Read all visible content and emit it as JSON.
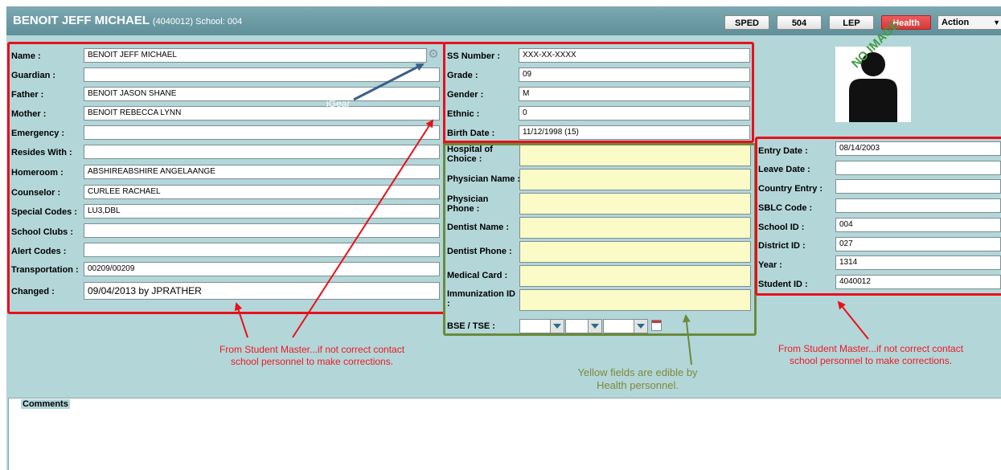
{
  "header": {
    "student_name": "BENOIT JEFF MICHAEL",
    "student_info": "(4040012) School: 004",
    "buttons": [
      "SPED",
      "504",
      "LEP",
      "Health"
    ],
    "action_label": "Action"
  },
  "left_panel": {
    "fields": [
      {
        "label": "Name :",
        "value": "BENOIT  JEFF MICHAEL"
      },
      {
        "label": "Guardian :",
        "value": ""
      },
      {
        "label": "Father :",
        "value": "BENOIT  JASON SHANE"
      },
      {
        "label": "Mother :",
        "value": "BENOIT  REBECCA LYNN"
      },
      {
        "label": "Emergency :",
        "value": ""
      },
      {
        "label": "Resides With :",
        "value": ""
      },
      {
        "label": "Homeroom :",
        "value": "ABSHIREABSHIRE ANGELAANGE"
      },
      {
        "label": "Counselor :",
        "value": "CURLEE RACHAEL"
      },
      {
        "label": "Special Codes :",
        "value": "LU3,DBL"
      },
      {
        "label": "School Clubs :",
        "value": ""
      },
      {
        "label": "Alert Codes :",
        "value": ""
      },
      {
        "label": "Transportation :",
        "value": "00209/00209"
      }
    ],
    "changed_label": "Changed :",
    "changed_value": "09/04/2013 by JPRATHER"
  },
  "middle_panel": {
    "fields": [
      {
        "label": "SS Number :",
        "value": "XXX-XX-XXXX"
      },
      {
        "label": "Grade :",
        "value": "09"
      },
      {
        "label": "Gender :",
        "value": "M"
      },
      {
        "label": "Ethnic :",
        "value": "0"
      },
      {
        "label": "Birth Date :",
        "value": "11/12/1998 (15)"
      }
    ]
  },
  "health_panel": {
    "fields": [
      {
        "label": "Hospital of Choice :",
        "value": ""
      },
      {
        "label": "Physician Name :",
        "value": ""
      },
      {
        "label": "Physician Phone :",
        "value": ""
      },
      {
        "label": "Dentist Name :",
        "value": ""
      },
      {
        "label": "Dentist Phone :",
        "value": ""
      },
      {
        "label": "Medical Card :",
        "value": ""
      },
      {
        "label": "Immunization ID :",
        "value": ""
      }
    ],
    "bse_label": "BSE / TSE :"
  },
  "right_panel": {
    "fields": [
      {
        "label": "Entry Date :",
        "value": "08/14/2003"
      },
      {
        "label": "Leave Date :",
        "value": ""
      },
      {
        "label": "Country Entry :",
        "value": ""
      },
      {
        "label": "SBLC Code :",
        "value": ""
      },
      {
        "label": "School ID :",
        "value": "004"
      },
      {
        "label": "District ID :",
        "value": "027"
      },
      {
        "label": "Year :",
        "value": "1314"
      },
      {
        "label": "Student ID :",
        "value": "4040012"
      }
    ]
  },
  "photo": {
    "text": "NO IMAGE"
  },
  "annotations": {
    "igear": "iGear",
    "left_note": [
      "From Student Master...if not correct contact",
      "school personnel to make corrections."
    ],
    "right_note": [
      "From Student Master...if not correct contact",
      "school personnel to make corrections."
    ],
    "yellow_note": [
      "Yellow fields are edible by",
      "Health personnel."
    ]
  },
  "comments": {
    "label": "Comments"
  },
  "colors": {
    "annotation_red": "#e8101a",
    "annotation_green": "#6a8a3a",
    "annotation_blue": "#3a5f8a",
    "editable_yellow": "#fbfbc8",
    "panel_bg": "#b3d6d9"
  }
}
